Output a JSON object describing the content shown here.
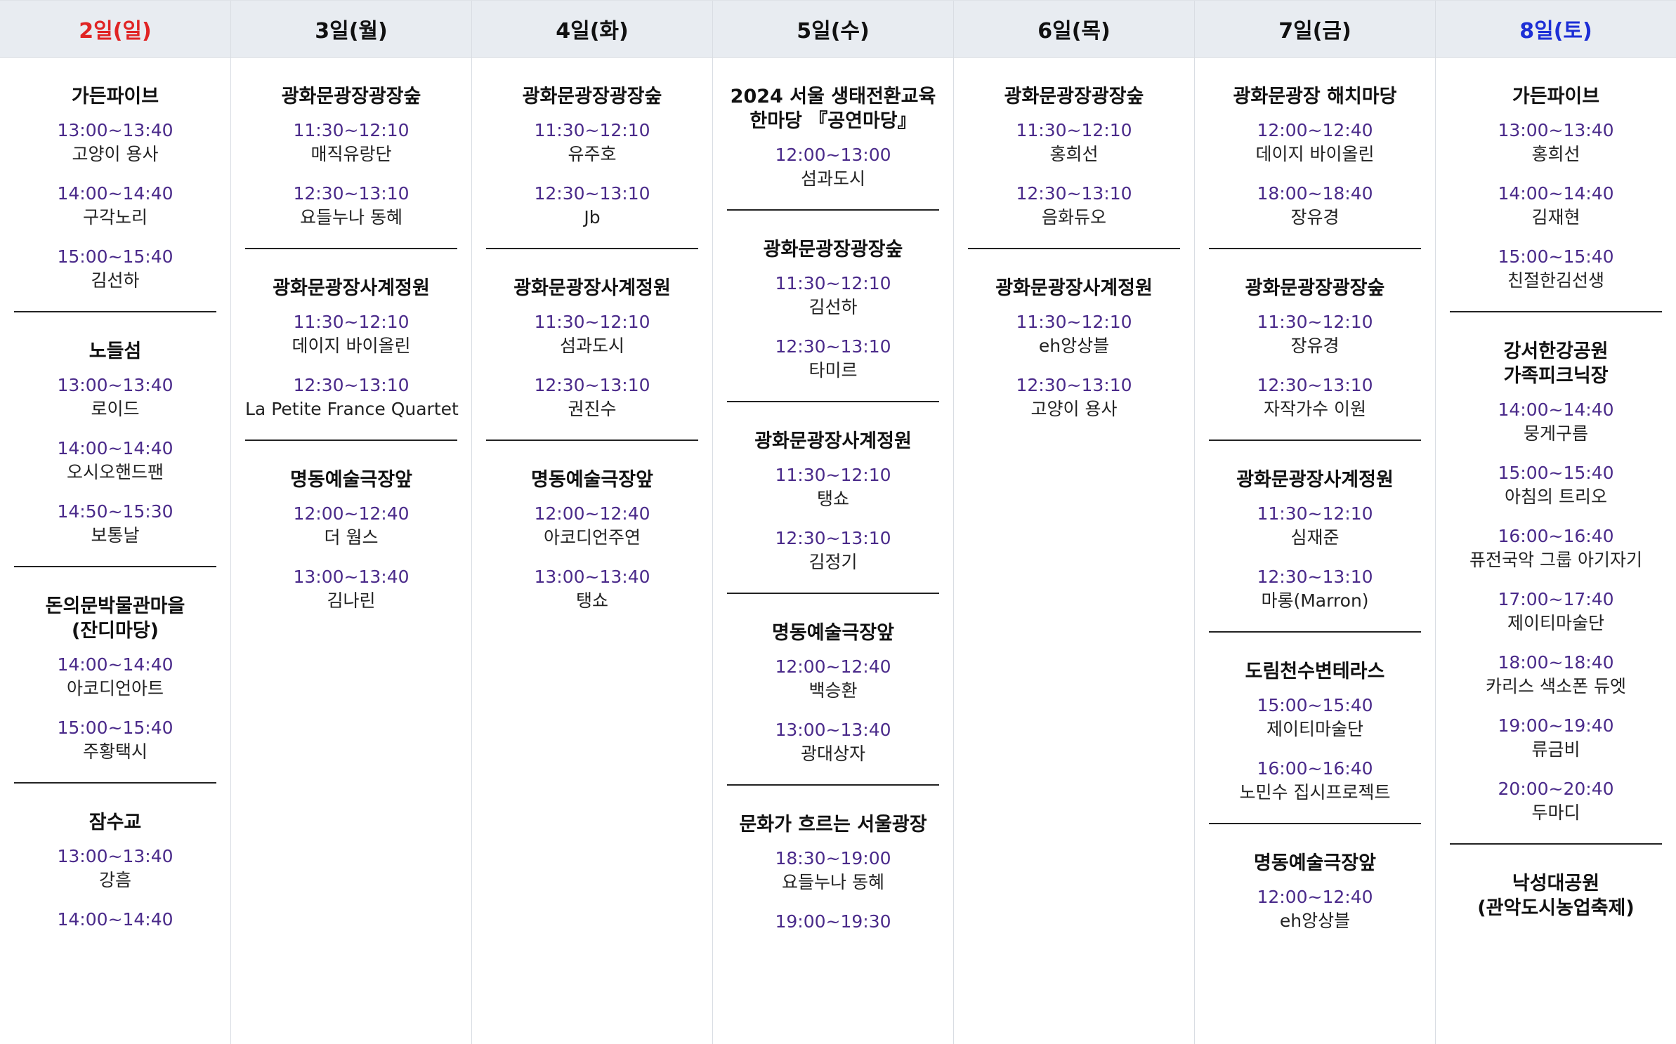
{
  "days": [
    {
      "header": "2일(일)",
      "color": "sun",
      "venues": [
        {
          "name": "가든파이브",
          "slots": [
            {
              "time": "13:00~13:40",
              "performer": "고양이 용사"
            },
            {
              "time": "14:00~14:40",
              "performer": "구각노리"
            },
            {
              "time": "15:00~15:40",
              "performer": "김선하"
            }
          ]
        },
        {
          "name": "노들섬",
          "slots": [
            {
              "time": "13:00~13:40",
              "performer": "로이드"
            },
            {
              "time": "14:00~14:40",
              "performer": "오시오핸드팬"
            },
            {
              "time": "14:50~15:30",
              "performer": "보통날"
            }
          ]
        },
        {
          "name": "돈의문박물관마을\n(잔디마당)",
          "slots": [
            {
              "time": "14:00~14:40",
              "performer": "아코디언아트"
            },
            {
              "time": "15:00~15:40",
              "performer": "주황택시"
            }
          ]
        },
        {
          "name": "잠수교",
          "slots": [
            {
              "time": "13:00~13:40",
              "performer": "강흠"
            },
            {
              "time": "14:00~14:40",
              "performer": ""
            }
          ]
        }
      ]
    },
    {
      "header": "3일(월)",
      "color": "",
      "venues": [
        {
          "name": "광화문광장광장숲",
          "slots": [
            {
              "time": "11:30~12:10",
              "performer": "매직유랑단"
            },
            {
              "time": "12:30~13:10",
              "performer": "요들누나 동혜"
            }
          ]
        },
        {
          "name": "광화문광장사계정원",
          "slots": [
            {
              "time": "11:30~12:10",
              "performer": "데이지 바이올린"
            },
            {
              "time": "12:30~13:10",
              "performer": "La Petite France Quartet"
            }
          ]
        },
        {
          "name": "명동예술극장앞",
          "slots": [
            {
              "time": "12:00~12:40",
              "performer": "더 웜스"
            },
            {
              "time": "13:00~13:40",
              "performer": "김나린"
            }
          ]
        }
      ]
    },
    {
      "header": "4일(화)",
      "color": "",
      "venues": [
        {
          "name": "광화문광장광장숲",
          "slots": [
            {
              "time": "11:30~12:10",
              "performer": "유주호"
            },
            {
              "time": "12:30~13:10",
              "performer": "Jb"
            }
          ]
        },
        {
          "name": "광화문광장사계정원",
          "slots": [
            {
              "time": "11:30~12:10",
              "performer": "섬과도시"
            },
            {
              "time": "12:30~13:10",
              "performer": "권진수"
            }
          ]
        },
        {
          "name": "명동예술극장앞",
          "slots": [
            {
              "time": "12:00~12:40",
              "performer": "아코디언주연"
            },
            {
              "time": "13:00~13:40",
              "performer": "탱쇼"
            }
          ]
        }
      ]
    },
    {
      "header": "5일(수)",
      "color": "",
      "venues": [
        {
          "name": "2024 서울 생태전환교육\n한마당 『공연마당』",
          "slots": [
            {
              "time": "12:00~13:00",
              "performer": "섬과도시"
            }
          ]
        },
        {
          "name": "광화문광장광장숲",
          "slots": [
            {
              "time": "11:30~12:10",
              "performer": "김선하"
            },
            {
              "time": "12:30~13:10",
              "performer": "타미르"
            }
          ]
        },
        {
          "name": "광화문광장사계정원",
          "slots": [
            {
              "time": "11:30~12:10",
              "performer": "탱쇼"
            },
            {
              "time": "12:30~13:10",
              "performer": "김정기"
            }
          ]
        },
        {
          "name": "명동예술극장앞",
          "slots": [
            {
              "time": "12:00~12:40",
              "performer": "백승환"
            },
            {
              "time": "13:00~13:40",
              "performer": "광대상자"
            }
          ]
        },
        {
          "name": "문화가 흐르는 서울광장",
          "slots": [
            {
              "time": "18:30~19:00",
              "performer": "요들누나 동혜"
            },
            {
              "time": "19:00~19:30",
              "performer": ""
            }
          ]
        }
      ]
    },
    {
      "header": "6일(목)",
      "color": "",
      "venues": [
        {
          "name": "광화문광장광장숲",
          "slots": [
            {
              "time": "11:30~12:10",
              "performer": "홍희선"
            },
            {
              "time": "12:30~13:10",
              "performer": "음화듀오"
            }
          ]
        },
        {
          "name": "광화문광장사계정원",
          "slots": [
            {
              "time": "11:30~12:10",
              "performer": "eh앙상블"
            },
            {
              "time": "12:30~13:10",
              "performer": "고양이 용사"
            }
          ]
        }
      ]
    },
    {
      "header": "7일(금)",
      "color": "",
      "venues": [
        {
          "name": "광화문광장 해치마당",
          "slots": [
            {
              "time": "12:00~12:40",
              "performer": "데이지 바이올린"
            },
            {
              "time": "18:00~18:40",
              "performer": "장유경"
            }
          ]
        },
        {
          "name": "광화문광장광장숲",
          "slots": [
            {
              "time": "11:30~12:10",
              "performer": "장유경"
            },
            {
              "time": "12:30~13:10",
              "performer": "자작가수 이원"
            }
          ]
        },
        {
          "name": "광화문광장사계정원",
          "slots": [
            {
              "time": "11:30~12:10",
              "performer": "심재준"
            },
            {
              "time": "12:30~13:10",
              "performer": "마롱(Marron)"
            }
          ]
        },
        {
          "name": "도림천수변테라스",
          "slots": [
            {
              "time": "15:00~15:40",
              "performer": "제이티마술단"
            },
            {
              "time": "16:00~16:40",
              "performer": "노민수 집시프로젝트"
            }
          ]
        },
        {
          "name": "명동예술극장앞",
          "slots": [
            {
              "time": "12:00~12:40",
              "performer": "eh앙상블"
            }
          ]
        }
      ]
    },
    {
      "header": "8일(토)",
      "color": "sat",
      "venues": [
        {
          "name": "가든파이브",
          "slots": [
            {
              "time": "13:00~13:40",
              "performer": "홍희선"
            },
            {
              "time": "14:00~14:40",
              "performer": "김재현"
            },
            {
              "time": "15:00~15:40",
              "performer": "친절한김선생"
            }
          ]
        },
        {
          "name": "강서한강공원\n가족피크닉장",
          "slots": [
            {
              "time": "14:00~14:40",
              "performer": "뭉게구름"
            },
            {
              "time": "15:00~15:40",
              "performer": "아침의 트리오"
            },
            {
              "time": "16:00~16:40",
              "performer": "퓨전국악 그룹 아기자기"
            },
            {
              "time": "17:00~17:40",
              "performer": "제이티마술단"
            },
            {
              "time": "18:00~18:40",
              "performer": "카리스 색소폰 듀엣"
            },
            {
              "time": "19:00~19:40",
              "performer": "류금비"
            },
            {
              "time": "20:00~20:40",
              "performer": "두마디"
            }
          ]
        },
        {
          "name": "낙성대공원\n(관악도시농업축제)",
          "slots": []
        }
      ]
    }
  ]
}
